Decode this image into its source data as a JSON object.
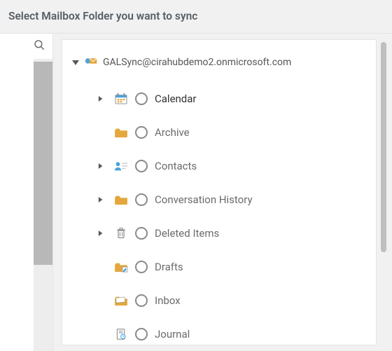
{
  "header": {
    "title": "Select Mailbox Folder you want to sync"
  },
  "mailbox": {
    "address": "GALSync@cirahubdemo2.onmicrosoft.com",
    "expanded": true
  },
  "folders": [
    {
      "name": "Calendar",
      "expandable": true,
      "icon": "calendar",
      "active": true
    },
    {
      "name": "Archive",
      "expandable": false,
      "icon": "folder",
      "active": false
    },
    {
      "name": "Contacts",
      "expandable": true,
      "icon": "contacts",
      "active": false
    },
    {
      "name": "Conversation History",
      "expandable": true,
      "icon": "folder",
      "active": false
    },
    {
      "name": "Deleted Items",
      "expandable": true,
      "icon": "trash",
      "active": false
    },
    {
      "name": "Drafts",
      "expandable": false,
      "icon": "drafts",
      "active": false
    },
    {
      "name": "Inbox",
      "expandable": false,
      "icon": "inbox",
      "active": false
    },
    {
      "name": "Journal",
      "expandable": false,
      "icon": "journal",
      "active": false
    }
  ],
  "colors": {
    "folder": "#e4a73e",
    "accent_blue": "#4aa3df",
    "icon_gray": "#8a8a8a"
  }
}
